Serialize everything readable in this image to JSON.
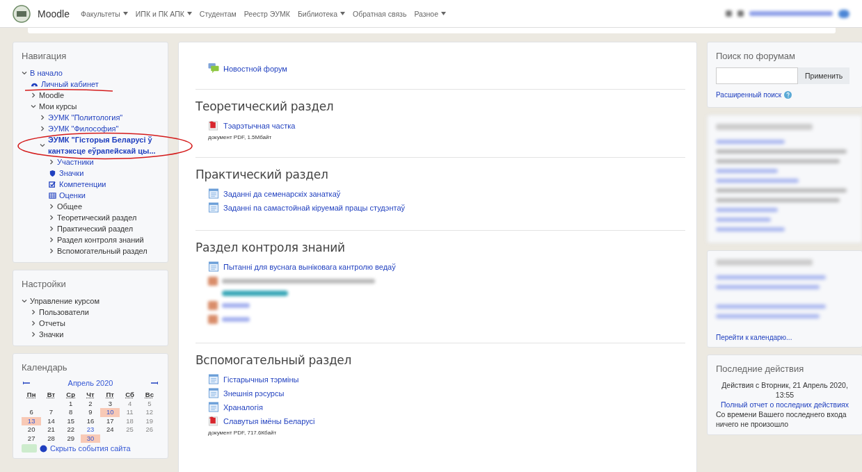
{
  "navbar": {
    "brand": "Moodle",
    "menu": [
      {
        "label": "Факультеты",
        "dropdown": true
      },
      {
        "label": "ИПК и ПК АПК",
        "dropdown": true
      },
      {
        "label": "Студентам",
        "dropdown": false
      },
      {
        "label": "Реестр ЭУМК",
        "dropdown": false
      },
      {
        "label": "Библиотека",
        "dropdown": true
      },
      {
        "label": "Обратная связь",
        "dropdown": false
      },
      {
        "label": "Разное",
        "dropdown": true
      }
    ]
  },
  "navigation": {
    "title": "Навигация",
    "items": [
      {
        "label": "В начало",
        "kind": "branch",
        "expanded": true,
        "link": true,
        "current": false,
        "children": [
          {
            "label": "Личный кабинет",
            "kind": "dashboard",
            "link": true,
            "current": false,
            "annotation": {
              "kind": "underline"
            }
          },
          {
            "label": "Moodle",
            "kind": "branch",
            "expanded": false,
            "link": false,
            "current": false
          },
          {
            "label": "Мои курсы",
            "kind": "branch",
            "expanded": true,
            "link": false,
            "current": false,
            "children": [
              {
                "label": "ЭУМК \"Политология\"",
                "kind": "branch",
                "expanded": false,
                "link": true,
                "current": false
              },
              {
                "label": "ЭУМК \"Философия\"",
                "kind": "branch",
                "expanded": false,
                "link": true,
                "current": false
              },
              {
                "label": "ЭУМК \"Гісторыя Беларусі ў кантэксце еўрапейскай цы...",
                "kind": "branch",
                "expanded": true,
                "link": true,
                "current": true,
                "annotation": {
                  "kind": "ellipse"
                },
                "children": [
                  {
                    "label": "Участники",
                    "kind": "branch",
                    "expanded": false,
                    "link": true,
                    "current": false
                  },
                  {
                    "label": "Значки",
                    "kind": "badges",
                    "link": true,
                    "current": false
                  },
                  {
                    "label": "Компетенции",
                    "kind": "competencies",
                    "link": true,
                    "current": false
                  },
                  {
                    "label": "Оценки",
                    "kind": "grades",
                    "link": true,
                    "current": false
                  },
                  {
                    "label": "Общее",
                    "kind": "branch",
                    "expanded": false,
                    "link": false,
                    "current": false
                  },
                  {
                    "label": "Теоретический раздел",
                    "kind": "branch",
                    "expanded": false,
                    "link": false,
                    "current": false
                  },
                  {
                    "label": "Практический раздел",
                    "kind": "branch",
                    "expanded": false,
                    "link": false,
                    "current": false
                  },
                  {
                    "label": "Раздел контроля знаний",
                    "kind": "branch",
                    "expanded": false,
                    "link": false,
                    "current": false
                  },
                  {
                    "label": "Вспомогательный раздел",
                    "kind": "branch",
                    "expanded": false,
                    "link": false,
                    "current": false
                  }
                ]
              }
            ]
          }
        ]
      }
    ]
  },
  "settings": {
    "title": "Настройки",
    "items": [
      {
        "label": "Управление курсом",
        "kind": "branch",
        "expanded": true,
        "link": false,
        "current": false,
        "children": [
          {
            "label": "Пользователи",
            "kind": "branch",
            "expanded": false,
            "link": false,
            "current": false
          },
          {
            "label": "Отчеты",
            "kind": "branch",
            "expanded": false,
            "link": false,
            "current": false
          },
          {
            "label": "Значки",
            "kind": "branch",
            "expanded": false,
            "link": false,
            "current": false
          }
        ]
      }
    ]
  },
  "calendar": {
    "title": "Календарь",
    "month": "Апрель 2020",
    "weekdays": [
      "Пн",
      "Вт",
      "Ср",
      "Чт",
      "Пт",
      "Сб",
      "Вс"
    ],
    "weeks": [
      [
        {
          "d": "1",
          "kind": "plain"
        },
        {
          "d": "2",
          "kind": "plain"
        },
        {
          "d": "3",
          "kind": "plain"
        },
        {
          "d": "4",
          "kind": "plain"
        },
        {
          "d": "5",
          "kind": "plain"
        }
      ],
      [
        {
          "d": "6",
          "kind": "plain"
        },
        {
          "d": "7",
          "kind": "plain"
        },
        {
          "d": "8",
          "kind": "plain"
        },
        {
          "d": "9",
          "kind": "plain"
        },
        {
          "d": "10",
          "kind": "event"
        },
        {
          "d": "11",
          "kind": "plain"
        },
        {
          "d": "12",
          "kind": "plain"
        }
      ],
      [
        {
          "d": "13",
          "kind": "event"
        },
        {
          "d": "14",
          "kind": "plain"
        },
        {
          "d": "15",
          "kind": "plain"
        },
        {
          "d": "16",
          "kind": "plain"
        },
        {
          "d": "17",
          "kind": "plain"
        },
        {
          "d": "18",
          "kind": "plain"
        },
        {
          "d": "19",
          "kind": "plain"
        }
      ],
      [
        {
          "d": "20",
          "kind": "plain"
        },
        {
          "d": "21",
          "kind": "plain"
        },
        {
          "d": "22",
          "kind": "plain"
        },
        {
          "d": "23",
          "kind": "link"
        },
        {
          "d": "24",
          "kind": "plain"
        },
        {
          "d": "25",
          "kind": "plain"
        },
        {
          "d": "26",
          "kind": "plain"
        }
      ],
      [
        {
          "d": "27",
          "kind": "plain"
        },
        {
          "d": "28",
          "kind": "plain"
        },
        {
          "d": "29",
          "kind": "plain"
        },
        {
          "d": "30",
          "kind": "event"
        }
      ]
    ],
    "footer_link": "Скрыть события сайта"
  },
  "course": {
    "top": [
      {
        "label": "Новостной форум",
        "kind": "forum"
      }
    ],
    "sections": [
      {
        "title": "Теоретический раздел",
        "items": [
          {
            "label": "Тэарэтычная частка",
            "kind": "pdf",
            "meta": "документ PDF, 1.5Мбайт"
          }
        ]
      },
      {
        "title": "Практический раздел",
        "items": [
          {
            "label": "Заданні да семенарскіх занаткаў",
            "kind": "page"
          },
          {
            "label": "Заданні па самастойнай кіруемай працы студэнтаў",
            "kind": "page"
          }
        ]
      },
      {
        "title": "Раздел контроля знаний",
        "items": [
          {
            "label": "Пытанні для вуснага выніковага кантролю ведаў",
            "kind": "page"
          },
          {
            "kind": "blurred"
          },
          {
            "kind": "blurred-badge"
          },
          {
            "kind": "blurred"
          },
          {
            "kind": "blurred"
          }
        ]
      },
      {
        "title": "Вспомогательный раздел",
        "items": [
          {
            "label": "Гістарычныя тэрміны",
            "kind": "page"
          },
          {
            "label": "Знешнія рэсурсы",
            "kind": "page"
          },
          {
            "label": "Храналогія",
            "kind": "page"
          },
          {
            "label": "Славутыя імёны Беларусі",
            "kind": "pdf",
            "meta": "документ PDF, 717.6Кбайт"
          }
        ]
      }
    ]
  },
  "forum_search": {
    "title": "Поиск по форумам",
    "button": "Применить",
    "advanced": "Расширенный поиск"
  },
  "calendar_link": "Перейти к календарю...",
  "recent_activity": {
    "title": "Последние действия",
    "since": "Действия с Вторник, 21 Апрель 2020, 13:55",
    "report_link": "Полный отчет о последних действиях",
    "empty": "Со времени Вашего последнего входа ничего не произошло"
  }
}
